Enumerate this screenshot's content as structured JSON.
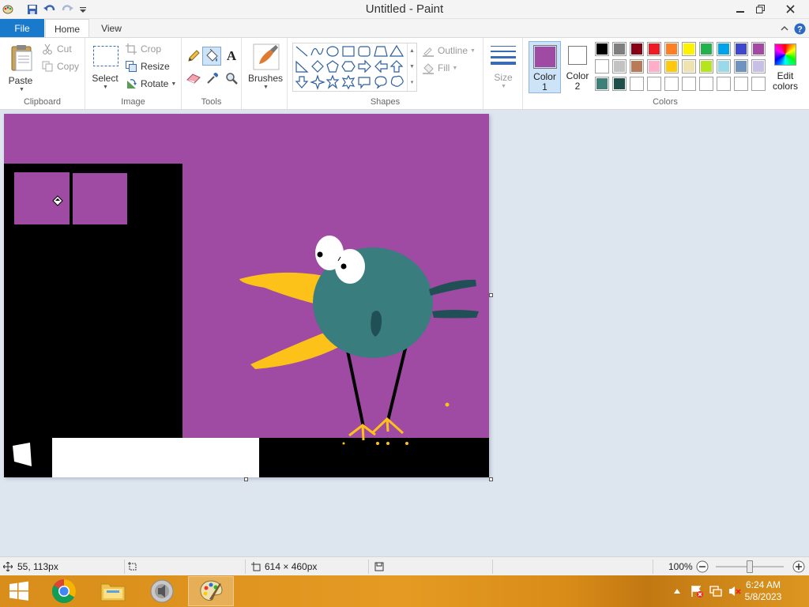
{
  "window": {
    "title": "Untitled - Paint"
  },
  "ribbon": {
    "tabs": {
      "file": "File",
      "home": "Home",
      "view": "View"
    },
    "clipboard": {
      "paste": "Paste",
      "cut": "Cut",
      "copy": "Copy",
      "label": "Clipboard"
    },
    "image": {
      "select": "Select",
      "crop": "Crop",
      "resize": "Resize",
      "rotate": "Rotate",
      "label": "Image"
    },
    "tools": {
      "label": "Tools",
      "text_glyph": "A"
    },
    "brushes": {
      "label": "Brushes"
    },
    "shapes": {
      "outline": "Outline",
      "fill": "Fill",
      "label": "Shapes"
    },
    "size": {
      "label": "Size"
    },
    "color1": {
      "line1": "Color",
      "line2": "1",
      "value": "#9f4aa3"
    },
    "color2": {
      "line1": "Color",
      "line2": "2",
      "value": "#ffffff"
    },
    "colors": {
      "label": "Colors",
      "edit_line1": "Edit",
      "edit_line2": "colors",
      "palette": [
        [
          "#000000",
          "#7f7f7f",
          "#880015",
          "#ed1c24",
          "#ff7f27",
          "#fff200",
          "#22b14c",
          "#00a2e8",
          "#3f48cc",
          "#a349a4"
        ],
        [
          "#ffffff",
          "#c3c3c3",
          "#b97a57",
          "#ffaec9",
          "#ffc90e",
          "#efe4b0",
          "#b5e61d",
          "#99d9ea",
          "#7092be",
          "#c8bfe7"
        ],
        [
          "#3f7f7a",
          "#1f4f4b",
          "#ffffff",
          "#ffffff",
          "#ffffff",
          "#ffffff",
          "#ffffff",
          "#ffffff",
          "#ffffff",
          "#ffffff"
        ]
      ]
    }
  },
  "statusbar": {
    "cursor_pos": "55, 113px",
    "image_size": "614 × 460px",
    "zoom": "100%",
    "zoom_slider_fraction": 0.5
  },
  "taskbar": {
    "time": "6:24 AM",
    "date": "5/8/2023"
  }
}
